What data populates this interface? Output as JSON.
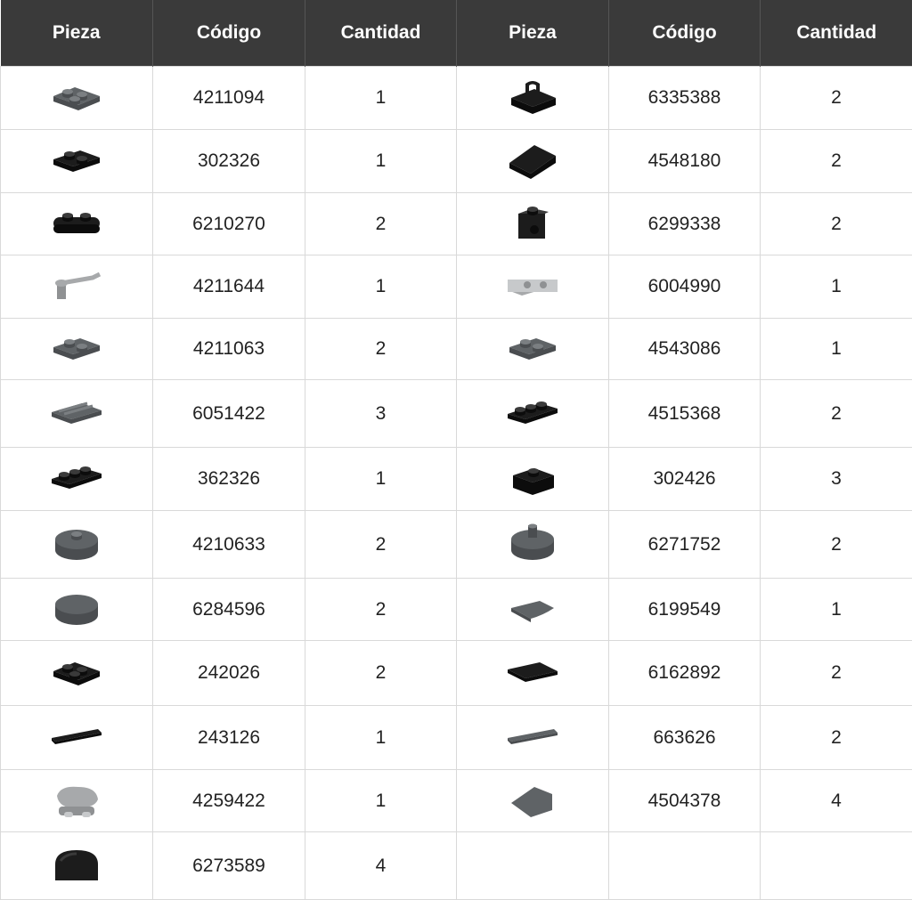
{
  "headers": [
    "Pieza",
    "Código",
    "Cantidad",
    "Pieza",
    "Código",
    "Cantidad"
  ],
  "rows": [
    {
      "left": {
        "icon": "plate-2x2-corner-dark-gray-icon",
        "code": "4211094",
        "qty": "1"
      },
      "right": {
        "icon": "plate-clip-black-icon",
        "code": "6335388",
        "qty": "2"
      }
    },
    {
      "left": {
        "icon": "plate-1x2-black-icon",
        "code": "302326",
        "qty": "1"
      },
      "right": {
        "icon": "slope-black-icon",
        "code": "4548180",
        "qty": "2"
      }
    },
    {
      "left": {
        "icon": "plate-rounded-black-icon",
        "code": "6210270",
        "qty": "2"
      },
      "right": {
        "icon": "bracket-black-icon",
        "code": "6299338",
        "qty": "2"
      }
    },
    {
      "left": {
        "icon": "bar-holder-light-gray-icon",
        "code": "4211644",
        "qty": "1"
      },
      "right": {
        "icon": "bracket-light-gray-icon",
        "code": "6004990",
        "qty": "1"
      }
    },
    {
      "left": {
        "icon": "plate-1x2-dark-gray-icon",
        "code": "4211063",
        "qty": "2"
      },
      "right": {
        "icon": "plate-rail-dark-gray-icon",
        "code": "4543086",
        "qty": "1"
      }
    },
    {
      "left": {
        "icon": "grille-tile-dark-gray-icon",
        "code": "6051422",
        "qty": "3"
      },
      "right": {
        "icon": "plate-bar-handles-black-icon",
        "code": "4515368",
        "qty": "2"
      }
    },
    {
      "left": {
        "icon": "plate-1x3-black-icon",
        "code": "362326",
        "qty": "1"
      },
      "right": {
        "icon": "brick-1x1-black-icon",
        "code": "302426",
        "qty": "3"
      }
    },
    {
      "left": {
        "icon": "round-plate-2x2-dark-gray-icon",
        "code": "4210633",
        "qty": "2"
      },
      "right": {
        "icon": "round-tile-pin-dark-gray-icon",
        "code": "6271752",
        "qty": "2"
      }
    },
    {
      "left": {
        "icon": "round-tile-2x2-dark-gray-icon",
        "code": "6284596",
        "qty": "2"
      },
      "right": {
        "icon": "quarter-tile-dark-gray-icon",
        "code": "6199549",
        "qty": "1"
      }
    },
    {
      "left": {
        "icon": "plate-2x2-corner-black-icon",
        "code": "242026",
        "qty": "2"
      },
      "right": {
        "icon": "tile-2x3-black-icon",
        "code": "6162892",
        "qty": "2"
      }
    },
    {
      "left": {
        "icon": "tile-1x4-black-icon",
        "code": "243126",
        "qty": "1"
      },
      "right": {
        "icon": "tile-1x6-dark-gray-icon",
        "code": "663626",
        "qty": "2"
      }
    },
    {
      "left": {
        "icon": "rock-light-gray-icon",
        "code": "4259422",
        "qty": "1"
      },
      "right": {
        "icon": "wedge-tile-dark-gray-icon",
        "code": "4504378",
        "qty": "4"
      }
    },
    {
      "left": {
        "icon": "curved-brick-black-icon",
        "code": "6273589",
        "qty": "4"
      },
      "right": {
        "icon": "",
        "code": "",
        "qty": ""
      }
    }
  ],
  "colors": {
    "header_bg": "#3a3a3a",
    "header_text": "#ffffff",
    "grid": "#d9d9d9",
    "black_part": "#1c1c1c",
    "dark_gray_part": "#5f6366",
    "light_gray_part": "#a7a9ab"
  }
}
